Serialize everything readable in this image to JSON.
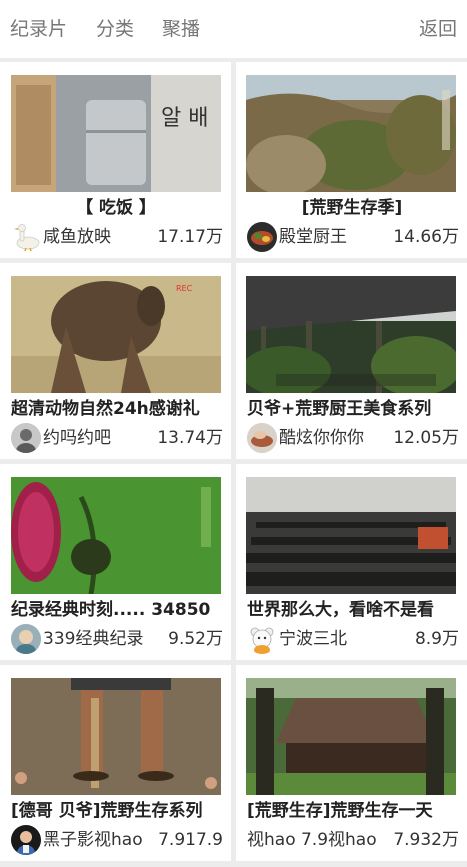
{
  "nav": {
    "tabs": [
      "纪录片",
      "分类",
      "聚播"
    ],
    "back_label": "返回"
  },
  "cards": [
    {
      "title": "【 吃饭 】",
      "author": "咸鱼放映",
      "count": "17.17万",
      "avatar": "goose-avatar"
    },
    {
      "title": "[荒野生存季]",
      "author": "殿堂厨王",
      "count": "14.66万",
      "avatar": "food-avatar"
    },
    {
      "title": "超清动物自然24h感谢礼",
      "author": "约吗约吧",
      "count": "13.74万",
      "avatar": "person-avatar"
    },
    {
      "title": "贝爷+荒野厨王美食系列",
      "author": "酷炫你你你",
      "count": "12.05万",
      "avatar": "hand-avatar"
    },
    {
      "title": "纪录经典时刻..... 34850",
      "author": "339经典纪录",
      "count": "9.52万",
      "avatar": "cartoon-avatar"
    },
    {
      "title": "世界那么大，看啥不是看",
      "author": "宁波三北",
      "count": "8.9万",
      "avatar": "bear-avatar"
    },
    {
      "title": "[德哥 贝爷]荒野生存系列",
      "author": "黑子影视hao",
      "count": "7.917.9",
      "avatar": "man-avatar"
    },
    {
      "title": "[荒野生存]荒野生存一天",
      "author": "视hao 7.9视hao",
      "count": "7.932万",
      "avatar": "none"
    }
  ],
  "colors": {
    "background": "#ececec",
    "card": "#ffffff",
    "text": "#222222",
    "muted": "#777777"
  }
}
